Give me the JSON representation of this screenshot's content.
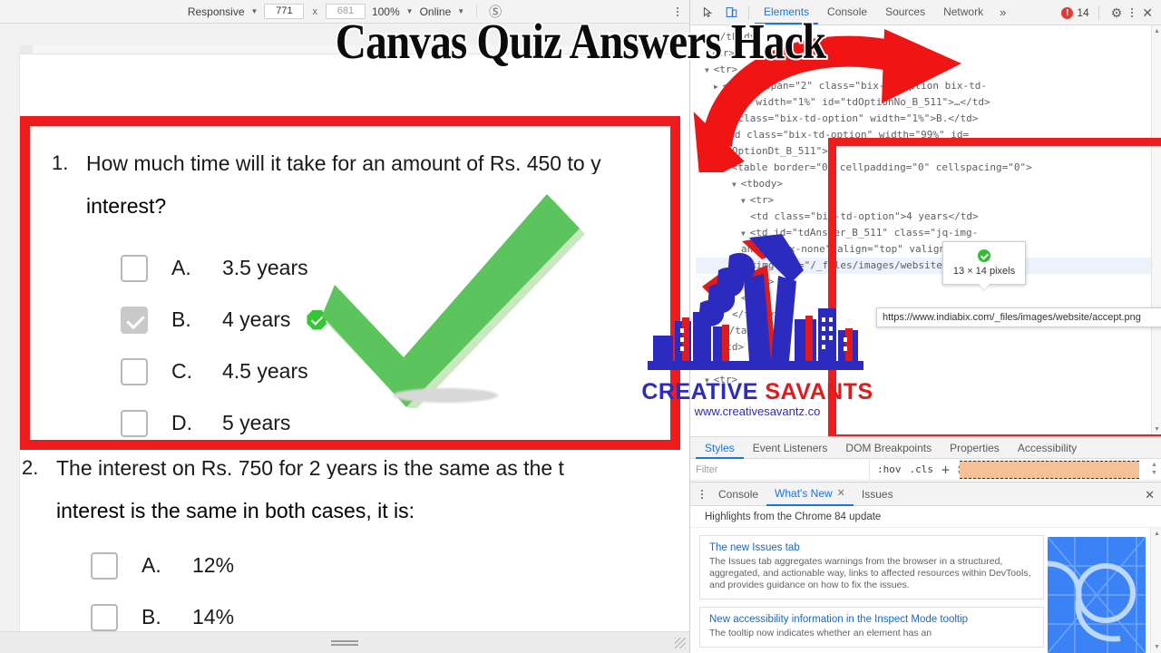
{
  "overlay": {
    "title": "Canvas Quiz Answers Hack",
    "brand_part1": "CREATIVE ",
    "brand_part2": "SAVANTS",
    "brand_url": "www.creativesavantz.co",
    "accent_red": "#ee1c1c",
    "brand_blue": "#2b2bc0"
  },
  "device_toolbar": {
    "device_label": "Responsive",
    "width": "771",
    "height": "681",
    "x_symbol": "x",
    "zoom": "100%",
    "network": "Online",
    "throttle_icon": "no-throttling-icon",
    "kebab_icon": "more-options-icon"
  },
  "quiz": {
    "questions": [
      {
        "number": "1.",
        "line1": "How much time will it take for an amount of Rs. 450 to y",
        "line2": "interest?",
        "options": [
          {
            "letter": "A.",
            "text": "3.5 years",
            "checked": false,
            "correct": false
          },
          {
            "letter": "B.",
            "text": "4 years",
            "checked": true,
            "correct": true
          },
          {
            "letter": "C.",
            "text": "4.5 years",
            "checked": false,
            "correct": false
          },
          {
            "letter": "D.",
            "text": "5 years",
            "checked": false,
            "correct": false
          }
        ]
      },
      {
        "number": "2.",
        "line1": "The interest on Rs. 750 for 2 years is the same as the t",
        "line2": "interest is the same in both cases, it is:",
        "options": [
          {
            "letter": "A.",
            "text": "12%",
            "checked": false,
            "correct": false
          },
          {
            "letter": "B.",
            "text": "14%",
            "checked": false,
            "correct": false
          }
        ]
      }
    ]
  },
  "devtools": {
    "inspect_icon": "inspect-element-icon",
    "device_icon": "device-toolbar-icon",
    "tabs": [
      {
        "label": "Elements",
        "active": true
      },
      {
        "label": "Console",
        "active": false
      },
      {
        "label": "Sources",
        "active": false
      },
      {
        "label": "Network",
        "active": false
      }
    ],
    "more_tabs": "»",
    "error_count": "14",
    "error_icon": "error-circle-icon",
    "settings_icon": "gear-icon",
    "menu_icon": "more-vertical-icon",
    "close_icon": "close-icon",
    "dom_lines": [
      {
        "indent": 2,
        "text": "</tbody>",
        "arrow": ""
      },
      {
        "indent": 1,
        "text": "</tr>",
        "arrow": ""
      },
      {
        "indent": 1,
        "text": "<tr>",
        "arrow": "▼"
      },
      {
        "indent": 2,
        "text": "<td rowspan=\"2\" class=\"bix-td-option bix-td-",
        "arrow": "▶"
      },
      {
        "indent": 2,
        "text": "radio\" width=\"1%\" id=\"tdOptionNo_B_511\">…</td>",
        "arrow": ""
      },
      {
        "indent": 2,
        "text": "<td class=\"bix-td-option\" width=\"1%\">B.</td>",
        "arrow": ""
      },
      {
        "indent": 2,
        "text": "<td class=\"bix-td-option\" width=\"99%\" id=",
        "arrow": "▼"
      },
      {
        "indent": 2,
        "text": "\"tdOptionDt_B_511\">",
        "arrow": ""
      },
      {
        "indent": 3,
        "text": "<table border=\"0\" cellpadding=\"0\" cellspacing=\"0\">",
        "arrow": "▼"
      },
      {
        "indent": 4,
        "text": "<tbody>",
        "arrow": "▼"
      },
      {
        "indent": 5,
        "text": "<tr>",
        "arrow": "▼"
      },
      {
        "indent": 6,
        "text": "<td class=\"bix-td-option\">4 years</td>",
        "arrow": ""
      },
      {
        "indent": 5,
        "text": "<td id=\"tdAnswer_B_511\" class=\"jq-img-",
        "arrow": "▼"
      },
      {
        "indent": 5,
        "text": "answer mx-none\" align=\"top\" valign=\"middle\">",
        "arrow": ""
      },
      {
        "indent": 6,
        "text": "<img src=\"/_files/images/website/accept.png\"",
        "arrow": "",
        "highlight": true
      },
      {
        "indent": 6,
        "text": "alt>",
        "arrow": ""
      },
      {
        "indent": 5,
        "text": "</tr>",
        "arrow": ""
      },
      {
        "indent": 4,
        "text": "</tbody>",
        "arrow": ""
      },
      {
        "indent": 3,
        "text": "</table>",
        "arrow": ""
      },
      {
        "indent": 2,
        "text": "</td>",
        "arrow": ""
      },
      {
        "indent": 1,
        "text": "</tr>",
        "arrow": ""
      },
      {
        "indent": 1,
        "text": "<tr>",
        "arrow": "▼"
      }
    ],
    "pixel_tooltip": "13 × 14 pixels",
    "pixel_tooltip_icon": "accept-check-icon",
    "url_tooltip": "https://www.indiabix.com/_files/images/website/accept.png",
    "sidebar_tabs": [
      {
        "label": "Styles",
        "active": true
      },
      {
        "label": "Event Listeners",
        "active": false
      },
      {
        "label": "DOM Breakpoints",
        "active": false
      },
      {
        "label": "Properties",
        "active": false
      },
      {
        "label": "Accessibility",
        "active": false
      }
    ],
    "filter_placeholder": "Filter",
    "hov_label": ":hov",
    "cls_label": ".cls",
    "plus_label": "+",
    "drawer": {
      "menu_icon": "drawer-more-icon",
      "tabs": [
        {
          "label": "Console",
          "active": false,
          "closable": false
        },
        {
          "label": "What's New",
          "active": true,
          "closable": true
        },
        {
          "label": "Issues",
          "active": false,
          "closable": false
        }
      ],
      "close_icon": "close-drawer-icon",
      "heading": "Highlights from the Chrome 84 update",
      "cards": [
        {
          "title": "The new Issues tab",
          "body": "The Issues tab aggregates warnings from the browser in a structured, aggregated, and actionable way, links to affected resources within DevTools, and provides guidance on how to fix the issues."
        },
        {
          "title": "New accessibility information in the Inspect Mode tooltip",
          "body": "The tooltip now indicates whether an element has an"
        }
      ],
      "image_alt": "chrome-devtools-promo-image"
    }
  }
}
